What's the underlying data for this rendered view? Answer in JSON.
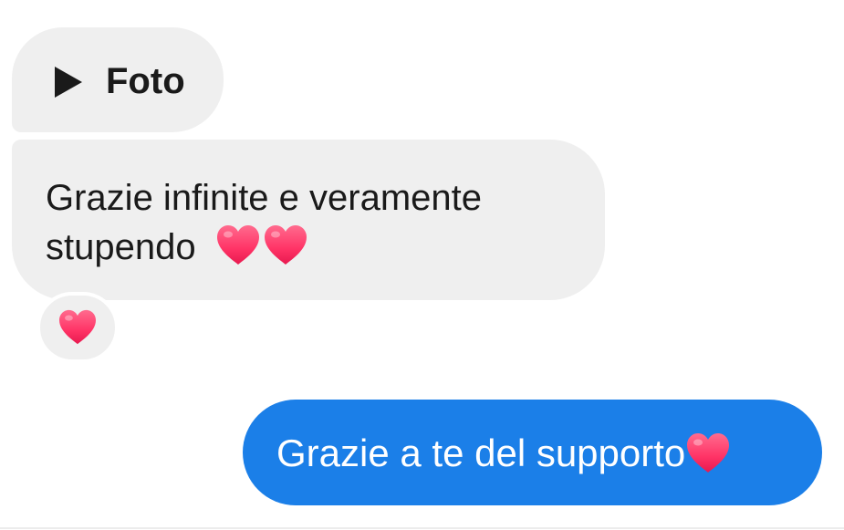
{
  "messages": {
    "received_attachment": {
      "icon": "play-icon",
      "label": "Foto"
    },
    "received_text": {
      "line1": "Grazie infinite e veramente",
      "line2": "stupendo",
      "emoji": [
        "heart-icon",
        "heart-icon"
      ]
    },
    "reaction": {
      "emoji": "heart-icon"
    },
    "sent_text": {
      "text": "Grazie a te del supporto",
      "emoji": "heart-icon"
    }
  },
  "colors": {
    "received_bubble": "#efefef",
    "sent_bubble": "#1b7fe8",
    "heart": "#ff3d6e",
    "text_dark": "#1a1a1a",
    "text_light": "#ffffff"
  }
}
